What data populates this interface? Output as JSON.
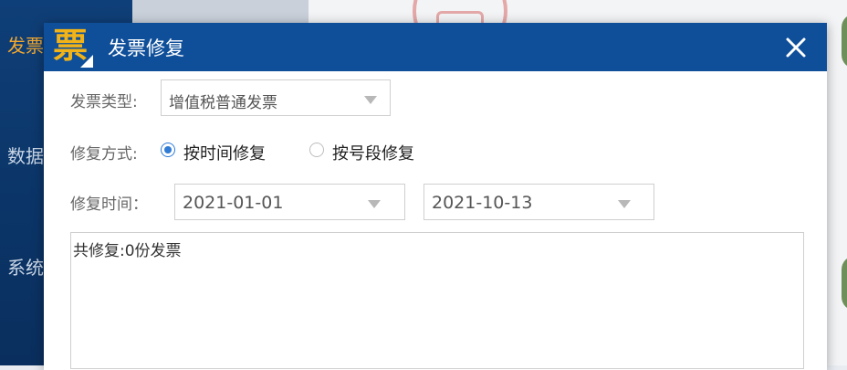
{
  "background": {
    "sidebar": {
      "items": [
        {
          "label": "发票"
        },
        {
          "label": "数据"
        },
        {
          "label": "系统"
        }
      ]
    }
  },
  "dialog": {
    "logo_char": "票",
    "title": "发票修复",
    "close_icon": "close-icon",
    "fields": {
      "invoice_type_label": "发票类型:",
      "invoice_type_value": "增值税普通发票",
      "repair_mode_label": "修复方式:",
      "repair_modes": [
        {
          "label": "按时间修复",
          "checked": true
        },
        {
          "label": "按号段修复",
          "checked": false
        }
      ],
      "repair_time_label": "修复时间：",
      "start_date": "2021-01-01",
      "end_date": "2021-10-13"
    },
    "result_text": "共修复:0份发票"
  },
  "colors": {
    "header": "#0f4f9a",
    "sidebar": "#0b3568",
    "active_sidebar": "#f0a830",
    "logo": "#f2b318",
    "radio_accent": "#2f7bd6"
  }
}
